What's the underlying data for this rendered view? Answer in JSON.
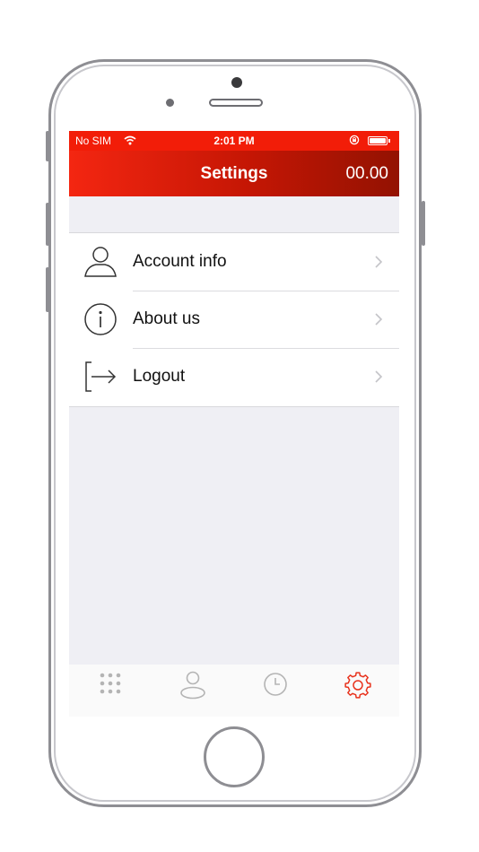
{
  "status_bar": {
    "carrier": "No SIM",
    "time": "2:01 PM",
    "wifi_icon": "wifi-icon",
    "lock_icon": "orientation-lock-icon",
    "battery_icon": "battery-icon"
  },
  "nav": {
    "title": "Settings",
    "balance": "00.00"
  },
  "menu": {
    "items": [
      {
        "label": "Account info",
        "icon": "user-icon"
      },
      {
        "label": "About us",
        "icon": "info-icon"
      },
      {
        "label": "Logout",
        "icon": "logout-icon"
      }
    ]
  },
  "tab_bar": {
    "tabs": [
      {
        "icon": "keypad-icon",
        "active": false
      },
      {
        "icon": "contact-icon",
        "active": false
      },
      {
        "icon": "clock-icon",
        "active": false
      },
      {
        "icon": "gear-icon",
        "active": true
      }
    ]
  },
  "colors": {
    "accent": "#e8321c",
    "header_gradient_start": "#f42611",
    "header_gradient_end": "#931202",
    "inactive_icon": "#b4b4b4",
    "background": "#efeff4"
  }
}
